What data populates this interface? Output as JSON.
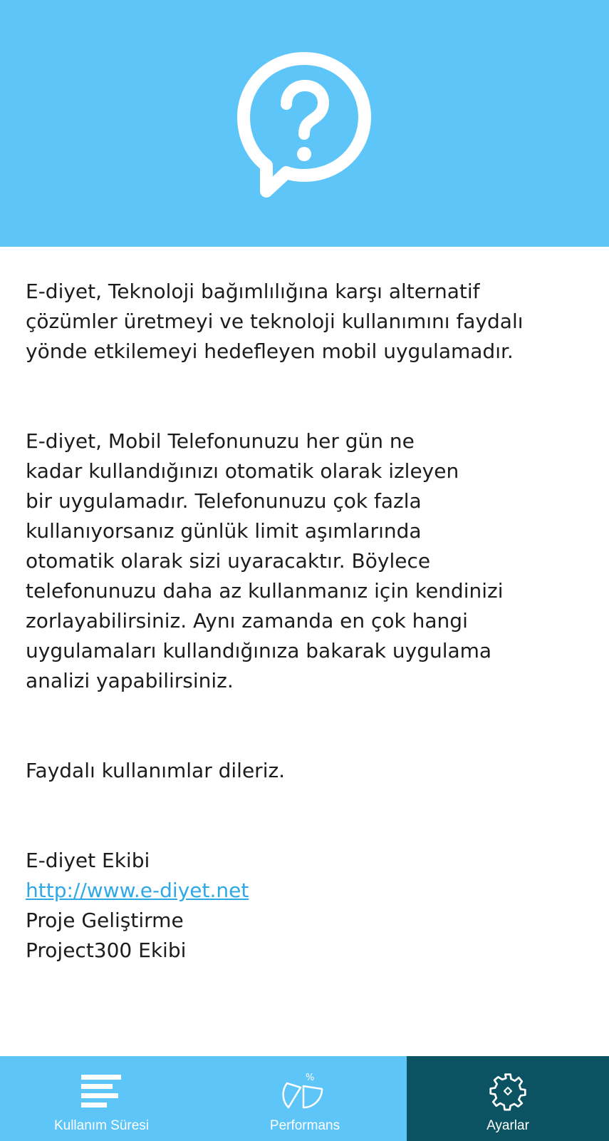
{
  "about": {
    "intro": "E-diyet, Teknoloji bağımlılığına karşı alternatif\nçözümler üretmeyi ve teknoloji kullanımını faydalı\nyönde etkilemeyi hedefleyen mobil uygulamadır.",
    "description": "E-diyet, Mobil Telefonunuzu her gün ne\nkadar kullandığınızı otomatik olarak izleyen\nbir uygulamadır. Telefonunuzu çok fazla\nkullanıyorsanız günlük limit aşımlarında\notomatik olarak sizi uyaracaktır. Böylece\ntelefonunuzu daha az kullanmanız için kendinizi\nzorlayabilirsiniz. Aynı zamanda en çok hangi\nuygulamaları kullandığınıza bakarak uygulama\nanalizi yapabilirsiniz.",
    "closing": "Faydalı kullanımlar dileriz.",
    "team": "E-diyet Ekibi",
    "website": "http://www.e-diyet.net",
    "dev_label": "Proje Geliştirme",
    "dev_team": "Project300 Ekibi"
  },
  "header": {
    "icon": "help-bubble-icon"
  },
  "nav": {
    "items": [
      {
        "label": "Kullanım Süresi",
        "icon": "bars-list-icon",
        "active": false
      },
      {
        "label": "Performans",
        "icon": "pie-percent-icon",
        "active": false
      },
      {
        "label": "Ayarlar",
        "icon": "gear-icon",
        "active": true
      }
    ]
  },
  "colors": {
    "header_bg": "#5ec5f8",
    "nav_bg": "#5ec5f8",
    "nav_active_bg": "#0b5362",
    "link": "#2fa8e6"
  }
}
